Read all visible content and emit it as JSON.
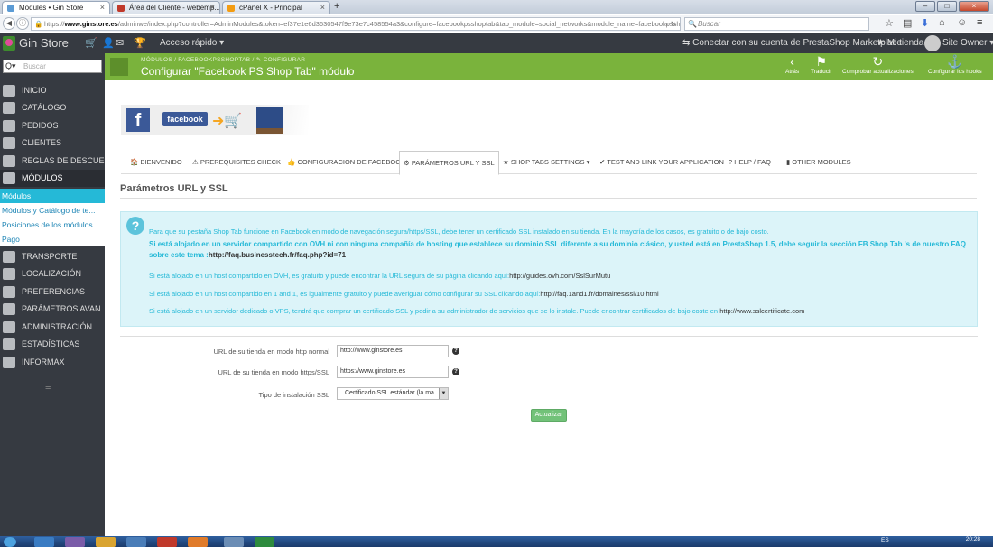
{
  "browser": {
    "tabs": [
      {
        "title": "Modules • Gin Store",
        "color": "#5b9bd5"
      },
      {
        "title": "Área del Cliente - webemp...",
        "color": "#c0392b"
      },
      {
        "title": "cPanel X - Principal",
        "color": "#f39c12"
      }
    ],
    "new_tab": "+",
    "url_domain": "www.ginstore.es",
    "url_prefix": "https://",
    "url_path": "/adminwe/index.php?controller=AdminModules&token=ef37e1e6d3630547f9e73e7c458554a3&configure=facebookpsshoptab&tab_module=social_networks&module_name=facebookpsshoptab",
    "search_placeholder": "Buscar"
  },
  "topbar": {
    "shop_name": "Gin Store",
    "quick_access": "Acceso rápido ▾",
    "marketplace": "Conectar con su cuenta de PrestaShop Marketplace",
    "my_shop": "Mi tienda",
    "owner": "Site Owner ▾"
  },
  "sidebar": {
    "search_placeholder": "Buscar",
    "items": [
      {
        "label": "Inicio"
      },
      {
        "label": "Catálogo"
      },
      {
        "label": "Pedidos"
      },
      {
        "label": "Clientes"
      },
      {
        "label": "Reglas de descue..."
      },
      {
        "label": "Módulos"
      }
    ],
    "subitems": [
      {
        "label": "Módulos"
      },
      {
        "label": "Módulos y Catálogo de te..."
      },
      {
        "label": "Posiciones de los módulos"
      },
      {
        "label": "Pago"
      }
    ],
    "items2": [
      {
        "label": "Transporte"
      },
      {
        "label": "Localización"
      },
      {
        "label": "Preferencias"
      },
      {
        "label": "Parámetros avan..."
      },
      {
        "label": "Administración"
      },
      {
        "label": "Estadísticas"
      },
      {
        "label": "Informax"
      }
    ],
    "collapse": "≡"
  },
  "header": {
    "breadcrumb_1": "MÓDULOS",
    "breadcrumb_2": "FACEBOOKPSSHOPTAB",
    "breadcrumb_3": "CONFIGURAR",
    "title": "Configurar \"Facebook PS Shop Tab\" módulo",
    "tools": [
      {
        "label": "Atrás",
        "icon": "‹"
      },
      {
        "label": "Traducir",
        "icon": "⚑"
      },
      {
        "label": "Comprobar actualizaciones",
        "icon": "↻"
      },
      {
        "label": "Configurar los hooks",
        "icon": "⚓"
      }
    ]
  },
  "banner": {
    "facebook_word": "facebook",
    "fb_letter": "f"
  },
  "module_tabs": [
    {
      "label": "BIENVENIDO",
      "icon": "🏠"
    },
    {
      "label": "PREREQUISITES CHECK",
      "icon": "⚠"
    },
    {
      "label": "CONFIGURACION DE FACEBOOK",
      "icon": "👍"
    },
    {
      "label": "PARÁMETROS URL Y SSL",
      "icon": "⚙"
    },
    {
      "label": "SHOP TABS SETTINGS ▾",
      "icon": "★"
    },
    {
      "label": "TEST AND LINK YOUR APPLICATION",
      "icon": "✔"
    },
    {
      "label": "HELP / FAQ",
      "icon": "?"
    },
    {
      "label": "OTHER MODULES",
      "icon": "▮"
    }
  ],
  "section_title": "Parámetros URL y SSL",
  "alert": {
    "line1": "Para que su pestaña Shop Tab funcione en Facebook en modo de navegación segura/https/SSL, debe tener un certificado SSL instalado en su tienda. En la mayoría de los casos, es gratuito o de bajo costo.",
    "line2": "Si está alojado en un servidor compartido con OVH ni con ninguna compañía de hosting que establece su dominio SSL diferente a su dominio clásico, y usted está en PrestaShop 1.5, debe seguir la sección FB Shop Tab 's de nuestro FAQ sobre este tema :",
    "line2_link": "http://faq.businesstech.fr/faq.php?id=71",
    "line3": "Si está alojado en un host compartido en OVH, es gratuito y puede encontrar la URL segura de su página clicando aquí:",
    "line3_link": "http://guides.ovh.com/SslSurMutu",
    "line4": "Si está alojado en un host compartido en 1 and 1, es igualmente gratuito y puede averiguar cómo configurar su SSL clicando aquí:",
    "line4_link": "http://faq.1and1.fr/domaines/ssl/10.html",
    "line5": "Si está alojado en un servidor dedicado o VPS, tendrá que comprar un certificado SSL y pedir a su administrador de servicios que se lo instale. Puede encontrar certificados de bajo coste en",
    "line5_link": "http://www.sslcertificate.com"
  },
  "form": {
    "http_label": "URL de su tienda en modo http normal",
    "http_value": "http://www.ginstore.es",
    "https_label": "URL de su tienda en modo https/SSL",
    "https_value": "https://www.ginstore.es",
    "ssl_label": "Tipo de instalación SSL",
    "ssl_value": "Certificado SSL estándar (la ma",
    "save": "Actualizar"
  },
  "taskbar": {
    "lang": "ES",
    "time": "20:28"
  },
  "colors": {
    "primary": "#25b9d7",
    "header_green": "#7ab33c",
    "sidebar": "#363a41",
    "save_green": "#72c279"
  }
}
